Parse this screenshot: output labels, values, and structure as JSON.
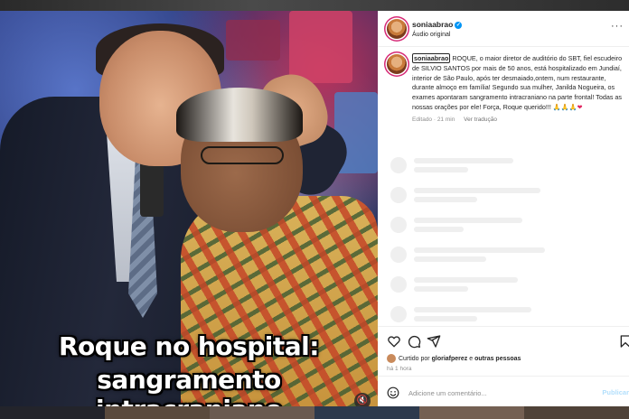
{
  "post": {
    "username": "soniaabrao",
    "audio_label": "Áudio original",
    "more_label": "···",
    "caption_line1": "Roque no hospital:",
    "caption_line2": "sangramento intracraniano",
    "mute_icon": "speaker-muted-icon"
  },
  "comment": {
    "username": "soniaabrao",
    "text": "ROQUE, o maior diretor de auditório do SBT, fiel escudeiro de SILVIO SANTOS por mais de 50 anos, está hospitalizado em Jundiaí, interior de São Paulo, após ter desmaiado,ontem, num restaurante, durante almoço em família! Segundo sua mulher, Janilda Nogueira, os exames apontaram sangramento intracraniano na parte frontal! Todas as nossas orações por ele! Força, Roque querido!!!",
    "hearts": " 🙏🙏🙏❤",
    "edited_label": "Editado · 21 min",
    "translate_label": "Ver tradução"
  },
  "actions": {
    "liked_prefix": "Curtido por",
    "liked_user": "gloriafperez",
    "liked_and": "e",
    "liked_others": "outras pessoas",
    "time": "há 1 hora"
  },
  "composer": {
    "placeholder": "Adicione um comentário...",
    "publish_label": "Publicar"
  },
  "colors": {
    "verified": "#0095f6",
    "story_ring": "#d62976",
    "publish_disabled": "#b2dffc"
  }
}
